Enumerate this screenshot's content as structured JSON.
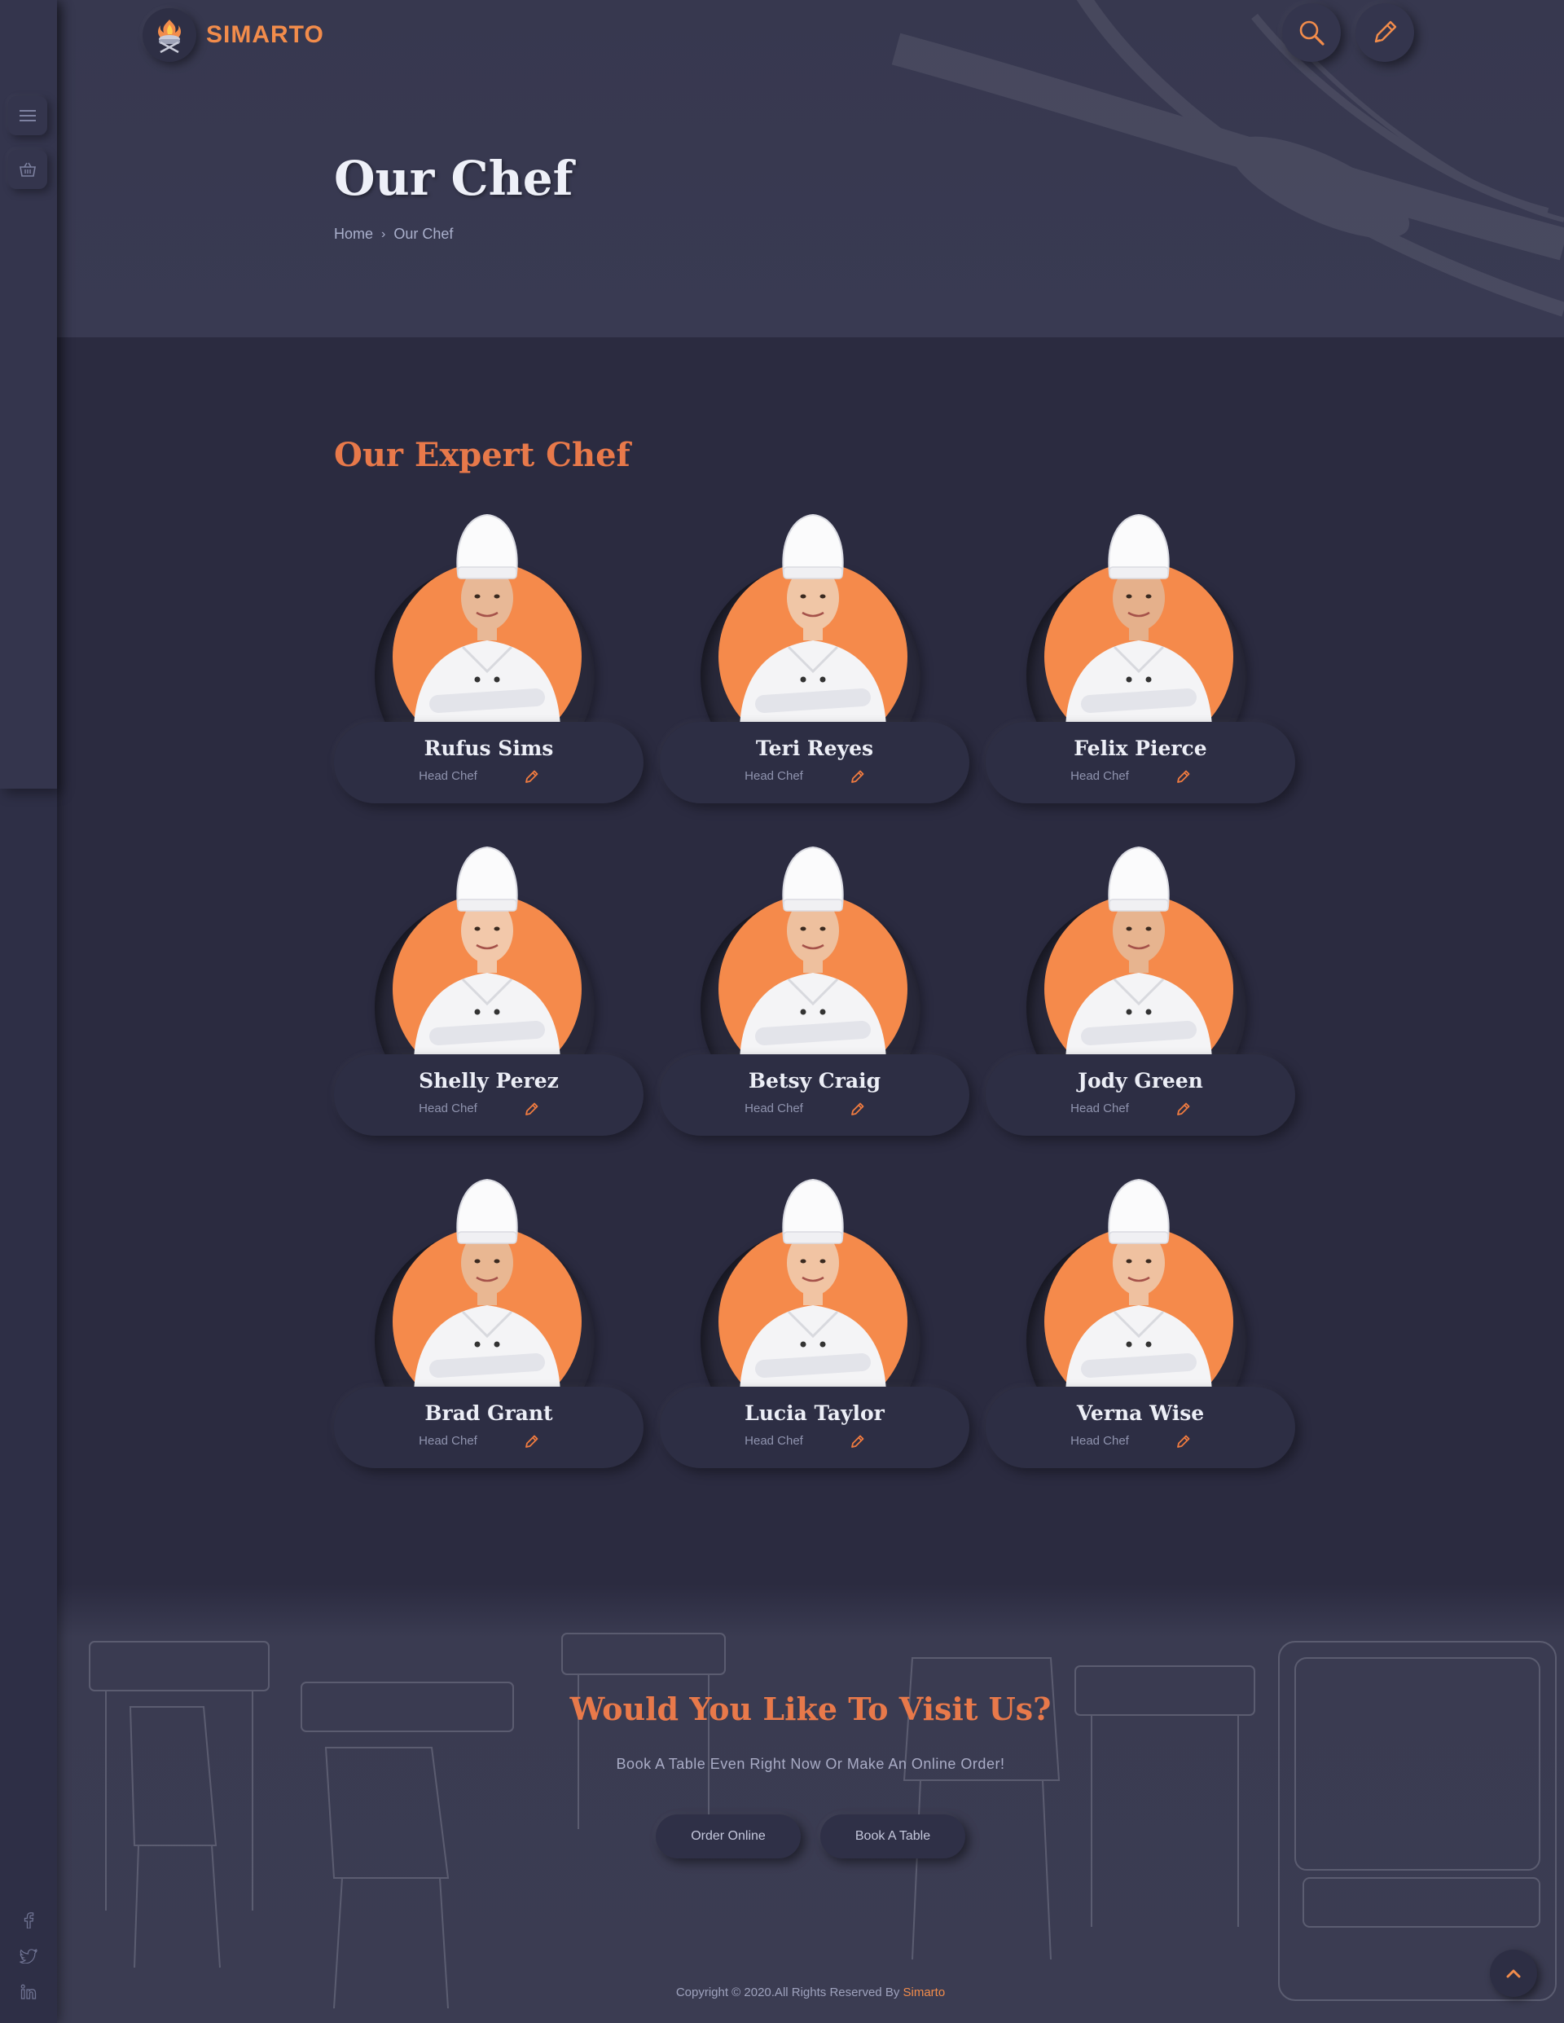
{
  "brand": {
    "name": "SIMARTO",
    "accent": "#f28c4b"
  },
  "header": {
    "search_icon": "search-icon",
    "edit_icon": "pencil-icon"
  },
  "sidebar": {
    "menu_icon": "hamburger-icon",
    "cart_icon": "basket-icon",
    "social": [
      "facebook-icon",
      "twitter-icon",
      "linkedin-icon"
    ]
  },
  "hero": {
    "title": "Our Chef",
    "breadcrumb": {
      "home": "Home",
      "current": "Our Chef"
    }
  },
  "chefs_section": {
    "title": "Our Expert Chef",
    "chefs": [
      {
        "name": "Rufus Sims",
        "role": "Head Chef"
      },
      {
        "name": "Teri Reyes",
        "role": "Head Chef"
      },
      {
        "name": "Felix Pierce",
        "role": "Head Chef"
      },
      {
        "name": "Shelly Perez",
        "role": "Head Chef"
      },
      {
        "name": "Betsy Craig",
        "role": "Head Chef"
      },
      {
        "name": "Jody Green",
        "role": "Head Chef"
      },
      {
        "name": "Brad Grant",
        "role": "Head Chef"
      },
      {
        "name": "Lucia Taylor",
        "role": "Head Chef"
      },
      {
        "name": "Verna Wise",
        "role": "Head Chef"
      }
    ]
  },
  "visit": {
    "title": "Would You Like To Visit Us?",
    "subtitle": "Book A Table Even Right Now Or Make An Online Order!",
    "order_label": "Order Online",
    "book_label": "Book A Table"
  },
  "footer": {
    "copyright": "Copyright © 2020.All Rights Reserved By ",
    "brand": "Simarto"
  }
}
